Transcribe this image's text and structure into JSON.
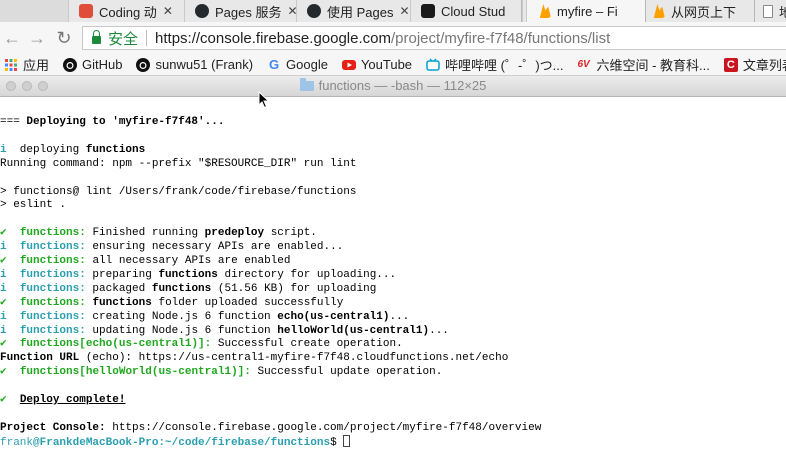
{
  "browser": {
    "tabs": [
      {
        "title": "Coding 动",
        "icon": "coding-favicon",
        "color": "#e04e39",
        "active": false
      },
      {
        "title": "Pages 服务",
        "icon": "octocat-favicon",
        "color": "#24292e",
        "active": false
      },
      {
        "title": "使用 Pages",
        "icon": "octocat-favicon",
        "color": "#24292e",
        "active": false
      },
      {
        "title": "Cloud Stud",
        "icon": "cloud-studio-favicon",
        "color": "#1a1a1a",
        "active": false
      },
      {
        "title": "myfire – Fi",
        "icon": "firebase-favicon",
        "color": "#ffa000",
        "active": true
      },
      {
        "title": "从网页上下",
        "icon": "firebase-favicon",
        "color": "#ffa000",
        "active": false
      },
      {
        "title": "地",
        "icon": "page-favicon",
        "color": "#ffffff",
        "active": false
      }
    ],
    "omnibox": {
      "secure_label": "安全",
      "url_host": "https://console.firebase.google.com",
      "url_path": "/project/myfire-f7f48/functions/list"
    },
    "bookmarks": [
      {
        "label": "应用",
        "icon": "apps-grid-icon"
      },
      {
        "label": "GitHub",
        "icon": "github-icon"
      },
      {
        "label": "sunwu51 (Frank)",
        "icon": "github-icon"
      },
      {
        "label": "Google",
        "icon": "google-icon"
      },
      {
        "label": "YouTube",
        "icon": "youtube-icon"
      },
      {
        "label": "哔哩哔哩 (゜-゜)つ...",
        "icon": "bilibili-icon"
      },
      {
        "label": "六维空间 - 教育科...",
        "icon": "6v-icon"
      },
      {
        "label": "文章列表",
        "icon": "csdn-icon"
      }
    ]
  },
  "terminal": {
    "title": "functions — -bash — 112×25",
    "colors": {
      "cyan": "#2a9fb0",
      "green": "#1fa81f"
    },
    "lines": [
      {
        "segs": [
          {
            "t": "=== "
          },
          {
            "t": "Deploying to 'myfire-f7f48'...",
            "c": "b"
          }
        ]
      },
      {
        "segs": []
      },
      {
        "segs": [
          {
            "t": "i",
            "c": "cy"
          },
          {
            "t": "  deploying "
          },
          {
            "t": "functions",
            "c": "b"
          }
        ]
      },
      {
        "segs": [
          {
            "t": "Running command: npm --prefix \"$RESOURCE_DIR\" run lint"
          }
        ]
      },
      {
        "segs": []
      },
      {
        "segs": [
          {
            "t": "> functions@ lint /Users/frank/code/firebase/functions"
          }
        ]
      },
      {
        "segs": [
          {
            "t": "> eslint ."
          }
        ]
      },
      {
        "segs": []
      },
      {
        "segs": [
          {
            "t": "✔",
            "c": "gr"
          },
          {
            "t": "  "
          },
          {
            "t": "functions:",
            "c": "gr"
          },
          {
            "t": " Finished running "
          },
          {
            "t": "predeploy",
            "c": "b"
          },
          {
            "t": " script."
          }
        ]
      },
      {
        "segs": [
          {
            "t": "i",
            "c": "cy"
          },
          {
            "t": "  "
          },
          {
            "t": "functions:",
            "c": "cy"
          },
          {
            "t": " ensuring necessary APIs are enabled..."
          }
        ]
      },
      {
        "segs": [
          {
            "t": "✔",
            "c": "gr"
          },
          {
            "t": "  "
          },
          {
            "t": "functions:",
            "c": "gr"
          },
          {
            "t": " all necessary APIs are enabled"
          }
        ]
      },
      {
        "segs": [
          {
            "t": "i",
            "c": "cy"
          },
          {
            "t": "  "
          },
          {
            "t": "functions:",
            "c": "cy"
          },
          {
            "t": " preparing "
          },
          {
            "t": "functions",
            "c": "b"
          },
          {
            "t": " directory for uploading..."
          }
        ]
      },
      {
        "segs": [
          {
            "t": "i",
            "c": "cy"
          },
          {
            "t": "  "
          },
          {
            "t": "functions:",
            "c": "cy"
          },
          {
            "t": " packaged "
          },
          {
            "t": "functions",
            "c": "b"
          },
          {
            "t": " (51.56 KB) for uploading"
          }
        ]
      },
      {
        "segs": [
          {
            "t": "✔",
            "c": "gr"
          },
          {
            "t": "  "
          },
          {
            "t": "functions:",
            "c": "gr"
          },
          {
            "t": " "
          },
          {
            "t": "functions",
            "c": "b"
          },
          {
            "t": " folder uploaded successfully"
          }
        ]
      },
      {
        "segs": [
          {
            "t": "i",
            "c": "cy"
          },
          {
            "t": "  "
          },
          {
            "t": "functions:",
            "c": "cy"
          },
          {
            "t": " creating Node.js 6 function "
          },
          {
            "t": "echo(us-central1)",
            "c": "b"
          },
          {
            "t": "..."
          }
        ]
      },
      {
        "segs": [
          {
            "t": "i",
            "c": "cy"
          },
          {
            "t": "  "
          },
          {
            "t": "functions:",
            "c": "cy"
          },
          {
            "t": " updating Node.js 6 function "
          },
          {
            "t": "helloWorld(us-central1)",
            "c": "b"
          },
          {
            "t": "..."
          }
        ]
      },
      {
        "segs": [
          {
            "t": "✔",
            "c": "gr"
          },
          {
            "t": "  "
          },
          {
            "t": "functions[echo(us-central1)]:",
            "c": "gr"
          },
          {
            "t": " Successful create operation."
          }
        ]
      },
      {
        "segs": [
          {
            "t": "Function URL",
            "c": "b"
          },
          {
            "t": " (echo): https://us-central1-myfire-f7f48.cloudfunctions.net/echo"
          }
        ]
      },
      {
        "segs": [
          {
            "t": "✔",
            "c": "gr"
          },
          {
            "t": "  "
          },
          {
            "t": "functions[helloWorld(us-central1)]:",
            "c": "gr"
          },
          {
            "t": " Successful update operation."
          }
        ]
      },
      {
        "segs": []
      },
      {
        "segs": [
          {
            "t": "✔",
            "c": "gr"
          },
          {
            "t": "  "
          },
          {
            "t": "Deploy complete!",
            "c": "b ul"
          }
        ]
      },
      {
        "segs": []
      },
      {
        "segs": [
          {
            "t": "Project Console:",
            "c": "b"
          },
          {
            "t": " https://console.firebase.google.com/project/myfire-f7f48/overview"
          }
        ]
      }
    ],
    "prompt": {
      "user": "frank",
      "host_path": "@FrankdeMacBook-Pro:~/code/firebase/functions",
      "symbol": "$ "
    }
  }
}
